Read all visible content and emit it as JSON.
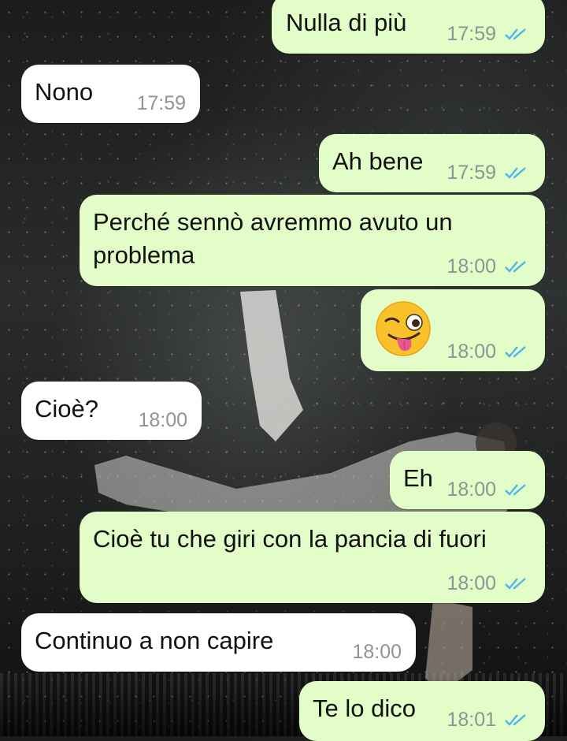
{
  "chat": {
    "messages": [
      {
        "direction": "out",
        "text": "Nulla di più",
        "time": "17:59",
        "status_icon": "double-check-icon"
      },
      {
        "direction": "in",
        "text": "Nono",
        "time": "17:59"
      },
      {
        "direction": "out",
        "text": "Ah bene",
        "time": "17:59",
        "status_icon": "double-check-icon"
      },
      {
        "direction": "out",
        "text": "Perché sennò avremmo avuto un problema",
        "time": "18:00",
        "status_icon": "double-check-icon"
      },
      {
        "direction": "out",
        "emoji": "winking-face-with-tongue-emoji",
        "time": "18:00",
        "status_icon": "double-check-icon"
      },
      {
        "direction": "in",
        "text": "Cioè?",
        "time": "18:00"
      },
      {
        "direction": "out",
        "text": "Eh",
        "time": "18:00",
        "status_icon": "double-check-icon"
      },
      {
        "direction": "out",
        "text": "Cioè tu che giri con la pancia di fuori",
        "time": "18:00",
        "status_icon": "double-check-icon"
      },
      {
        "direction": "in",
        "text": "Continuo a non capire",
        "time": "18:00"
      },
      {
        "direction": "out",
        "text": "Te lo dico",
        "time": "18:01",
        "status_icon": "double-check-icon"
      }
    ]
  },
  "colors": {
    "outgoing_bubble": "#e2fdc8",
    "incoming_bubble": "#ffffff",
    "read_tick": "#4fb5ec",
    "timestamp": "#8d9492"
  },
  "background": {
    "type": "wallpaper-photo",
    "subject": "footballer-bicycle-kick-in-rain"
  }
}
